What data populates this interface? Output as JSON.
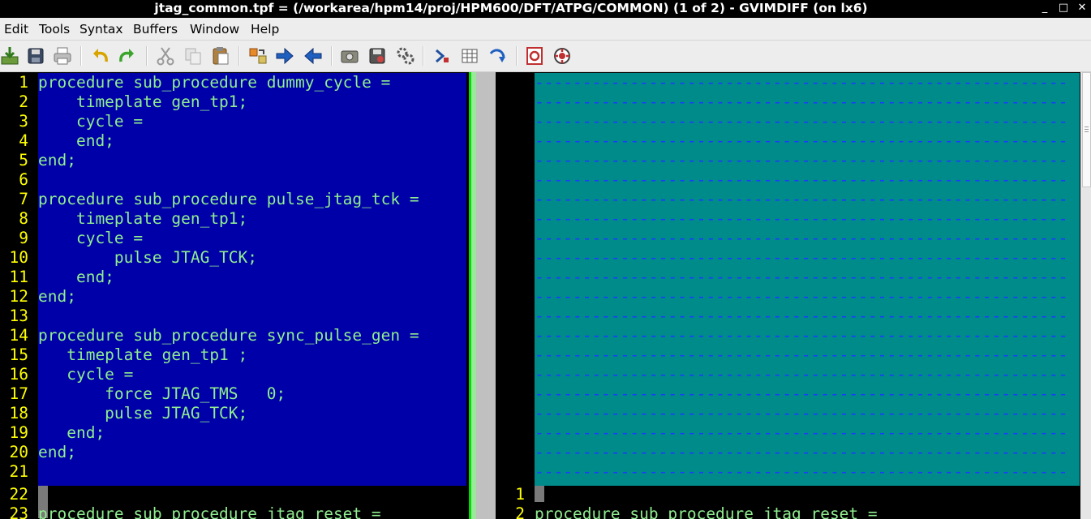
{
  "window": {
    "title": "jtag_common.tpf = (/workarea/hpm14/proj/HPM600/DFT/ATPG/COMMON) (1 of 2) - GVIMDIFF (on lx6)",
    "minimize": "_",
    "maximize": "□",
    "close": "✕"
  },
  "menu": {
    "items": [
      "Edit",
      "Tools",
      "Syntax",
      "Buffers",
      "Window",
      "Help"
    ]
  },
  "toolbar": {
    "icons": [
      "open-file-icon",
      "save-icon",
      "print-icon",
      "undo-icon",
      "redo-icon",
      "cut-icon",
      "copy-icon",
      "paste-icon",
      "find-replace-icon",
      "find-next-icon",
      "find-previous-icon",
      "load-session-icon",
      "save-session-icon",
      "run-script-icon",
      "make-icon",
      "shell-icon",
      "tag-jump-icon",
      "help-icon",
      "find-help-icon"
    ]
  },
  "colors": {
    "diff_changed_bg": "#0000a8",
    "diff_filler_bg": "#008b8b",
    "filler_dash": "#1b3bff",
    "line_number": "#ffff00",
    "code_text": "#90ee90",
    "cursor_green": "#00dd00"
  },
  "left_pane": {
    "lines": [
      {
        "n": "1",
        "t": "procedure sub_procedure dummy_cycle =",
        "diff": true
      },
      {
        "n": "2",
        "t": "    timeplate gen_tp1;",
        "diff": true
      },
      {
        "n": "3",
        "t": "    cycle =",
        "diff": true
      },
      {
        "n": "4",
        "t": "    end;",
        "diff": true
      },
      {
        "n": "5",
        "t": "end;",
        "diff": true
      },
      {
        "n": "6",
        "t": "",
        "diff": true
      },
      {
        "n": "7",
        "t": "procedure sub_procedure pulse_jtag_tck =",
        "diff": true
      },
      {
        "n": "8",
        "t": "    timeplate gen_tp1;",
        "diff": true
      },
      {
        "n": "9",
        "t": "    cycle =",
        "diff": true
      },
      {
        "n": "10",
        "t": "        pulse JTAG_TCK;",
        "diff": true
      },
      {
        "n": "11",
        "t": "    end;",
        "diff": true
      },
      {
        "n": "12",
        "t": "end;",
        "diff": true
      },
      {
        "n": "13",
        "t": "",
        "diff": true
      },
      {
        "n": "14",
        "t": "procedure sub_procedure sync_pulse_gen =",
        "diff": true
      },
      {
        "n": "15",
        "t": "   timeplate gen_tp1 ;",
        "diff": true
      },
      {
        "n": "16",
        "t": "   cycle =",
        "diff": true
      },
      {
        "n": "17",
        "t": "       force JTAG_TMS   0;",
        "diff": true
      },
      {
        "n": "18",
        "t": "       pulse JTAG_TCK;",
        "diff": true
      },
      {
        "n": "19",
        "t": "   end;",
        "diff": true
      },
      {
        "n": "20",
        "t": "end;",
        "diff": true
      },
      {
        "n": "21",
        "t": "",
        "diff": true
      },
      {
        "n": "22",
        "t": "",
        "diff": false
      },
      {
        "n": "23",
        "t": "procedure sub_procedure jtag_reset =",
        "diff": false
      }
    ]
  },
  "right_pane": {
    "filler_line_count": 21,
    "filler_text": "--------------------------------------------------------",
    "lines": [
      {
        "n": "1",
        "t": ""
      },
      {
        "n": "2",
        "t": "procedure sub_procedure jtag_reset ="
      }
    ]
  }
}
